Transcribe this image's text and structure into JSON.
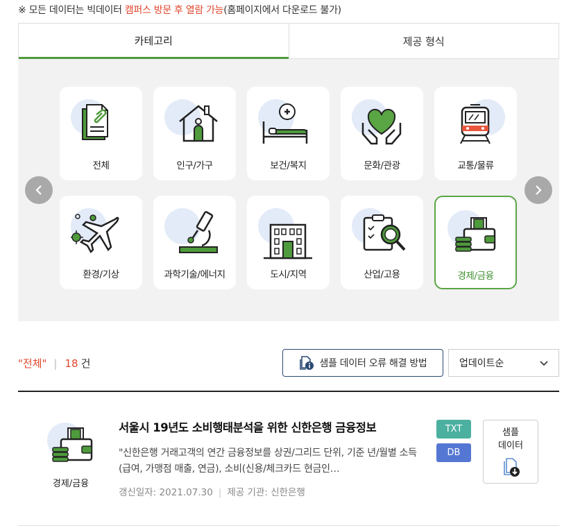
{
  "notice": {
    "prefix": "※ 모든 데이터는 빅데이터 ",
    "highlight": "캠퍼스 방문 후 열람 가능",
    "suffix": "(홈페이지에서 다운로드 불가)"
  },
  "tabs": [
    {
      "label": "카테고리",
      "active": true
    },
    {
      "label": "제공 형식",
      "active": false
    }
  ],
  "categories": [
    {
      "label": "전체",
      "icon": "documents-icon"
    },
    {
      "label": "인구/가구",
      "icon": "house-person-icon"
    },
    {
      "label": "보건/복지",
      "icon": "hospital-bed-icon"
    },
    {
      "label": "문화/관광",
      "icon": "hands-heart-icon"
    },
    {
      "label": "교통/물류",
      "icon": "train-icon"
    },
    {
      "label": "환경/기상",
      "icon": "airplane-virus-icon"
    },
    {
      "label": "과학기술/에너지",
      "icon": "microscope-icon"
    },
    {
      "label": "도시/지역",
      "icon": "building-icon"
    },
    {
      "label": "산업/고용",
      "icon": "clipboard-magnifier-icon"
    },
    {
      "label": "경제/금융",
      "icon": "wallet-coins-icon",
      "selected": true
    }
  ],
  "results": {
    "selected_label": "\"전체\"",
    "count": "18",
    "unit": "건",
    "help_button": "샘플 데이터 오류 해결 방법",
    "sort": "업데이트순"
  },
  "items": [
    {
      "category": "경제/금융",
      "title": "서울시 19년도 소비행태분석을 위한 신한은행 금융정보",
      "desc": "\"신한은행 거래고객의 연간 금융정보를 상권/그리드 단위, 기준 년/월별 소득(급여, 가맹점 매출, 연금), 소비(신용/체크카드 현금인…",
      "updated": "갱신일자: 2021.07.30",
      "provider": "제공 기관: 신한은행",
      "formats": [
        "TXT",
        "DB"
      ],
      "sample_label": "샘플\n데이터"
    }
  ],
  "colors": {
    "accent_green": "#4e9a3c",
    "highlight_red": "#e0452b",
    "navy": "#2b4a74",
    "txt_badge": "#4bb0a0",
    "db_badge": "#5577d4"
  }
}
